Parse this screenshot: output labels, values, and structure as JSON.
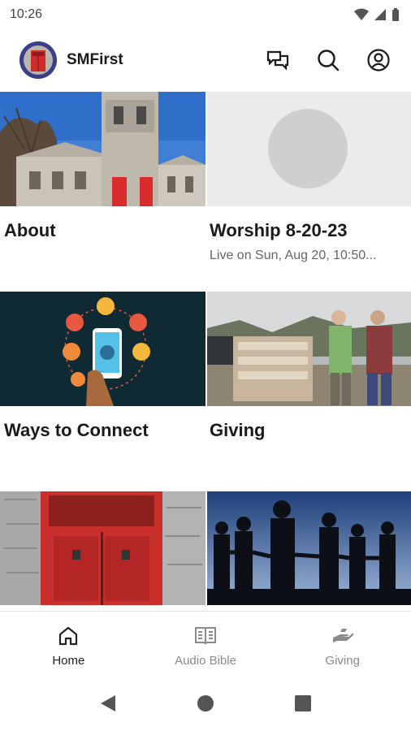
{
  "status_bar": {
    "time": "10:26",
    "icons": [
      "wifi-icon",
      "signal-icon",
      "battery-icon"
    ]
  },
  "header": {
    "title": "SMFirst",
    "actions": [
      "chat-icon",
      "search-icon",
      "account-icon"
    ]
  },
  "tiles": [
    {
      "title": "About",
      "subtitle": ""
    },
    {
      "title": "Worship 8-20-23",
      "subtitle": "Live on Sun, Aug 20, 10:50..."
    },
    {
      "title": "Ways to Connect",
      "subtitle": ""
    },
    {
      "title": "Giving",
      "subtitle": ""
    },
    {
      "title": "",
      "subtitle": ""
    },
    {
      "title": "",
      "subtitle": ""
    }
  ],
  "bottom_nav": [
    {
      "label": "Home",
      "icon": "home-icon",
      "active": true
    },
    {
      "label": "Audio Bible",
      "icon": "book-icon",
      "active": false
    },
    {
      "label": "Giving",
      "icon": "giving-hand-icon",
      "active": false
    }
  ],
  "colors": {
    "accent": "#3a3f8c",
    "door_red": "#d92b2b",
    "nav_inactive": "#8a8a8a"
  }
}
